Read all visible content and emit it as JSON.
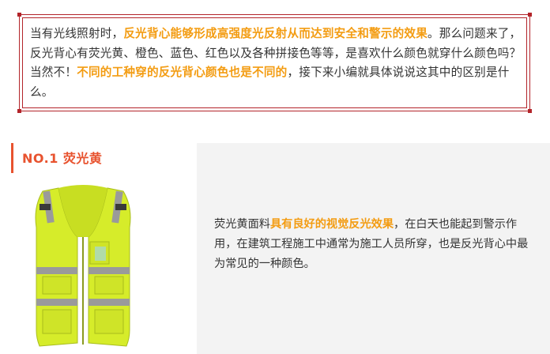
{
  "intro": {
    "part1": "当有光线照射时，",
    "highlight1": "反光背心能够形成高强度光反射从而达到安全和警示的效果",
    "part2": "。那么问题来了，反光背心有荧光黄、橙色、蓝色、红色以及各种拼接色等等，是喜欢什么颜色就穿什么颜色吗？当然不！",
    "highlight2": "不同的工种穿的反光背心颜色也是不同的",
    "part3": "，接下来小编就具体说说这其中的区别是什么。"
  },
  "section": {
    "heading": "NO.1  荧光黄",
    "desc_part1": "荧光黄面料",
    "desc_highlight": "具有良好的视觉反光效果",
    "desc_part2": "，在白天也能起到警示作用，在建筑工程施工中通常为施工人员所穿，也是反光背心中最为常见的一种颜色。"
  },
  "colors": {
    "frame_red": "#b3242a",
    "heading_orange": "#e8532f",
    "highlight_orange": "#f39c12",
    "vest_yellow": "#d6ec2a",
    "reflective_gray": "#9a9a9a",
    "panel_gray": "#f3f3f3"
  }
}
